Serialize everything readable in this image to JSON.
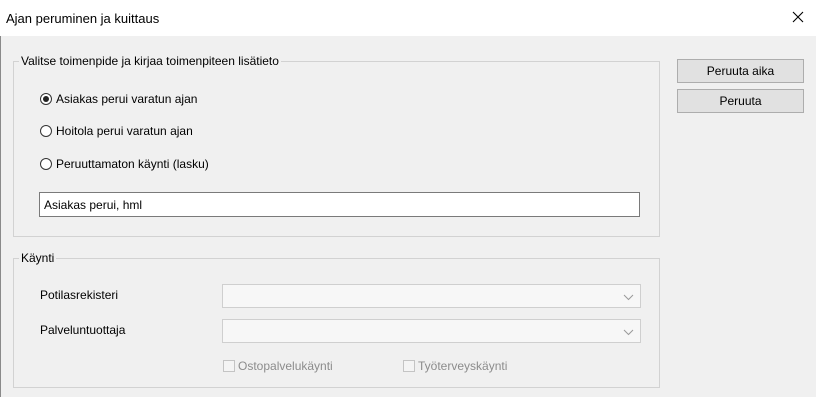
{
  "window": {
    "title": "Ajan peruminen ja kuittaus",
    "close_icon": "close-icon"
  },
  "action_group": {
    "legend": "Valitse toimenpide ja kirjaa toimenpiteen lisätieto",
    "options": [
      {
        "label": "Asiakas perui varatun ajan",
        "selected": true
      },
      {
        "label": "Hoitola perui varatun ajan",
        "selected": false
      },
      {
        "label": "Peruuttamaton käynti (lasku)",
        "selected": false
      }
    ],
    "note_value": "Asiakas perui, hml"
  },
  "visit_group": {
    "legend": "Käynti",
    "patient_register_label": "Potilasrekisteri",
    "patient_register_value": "",
    "provider_label": "Palveluntuottaja",
    "provider_value": "",
    "outsourced_label": "Ostopalvelukäynti",
    "outsourced_checked": false,
    "occupational_label": "Työterveyskäynti",
    "occupational_checked": false
  },
  "buttons": {
    "cancel_appointment": "Peruuta aika",
    "cancel": "Peruuta"
  }
}
